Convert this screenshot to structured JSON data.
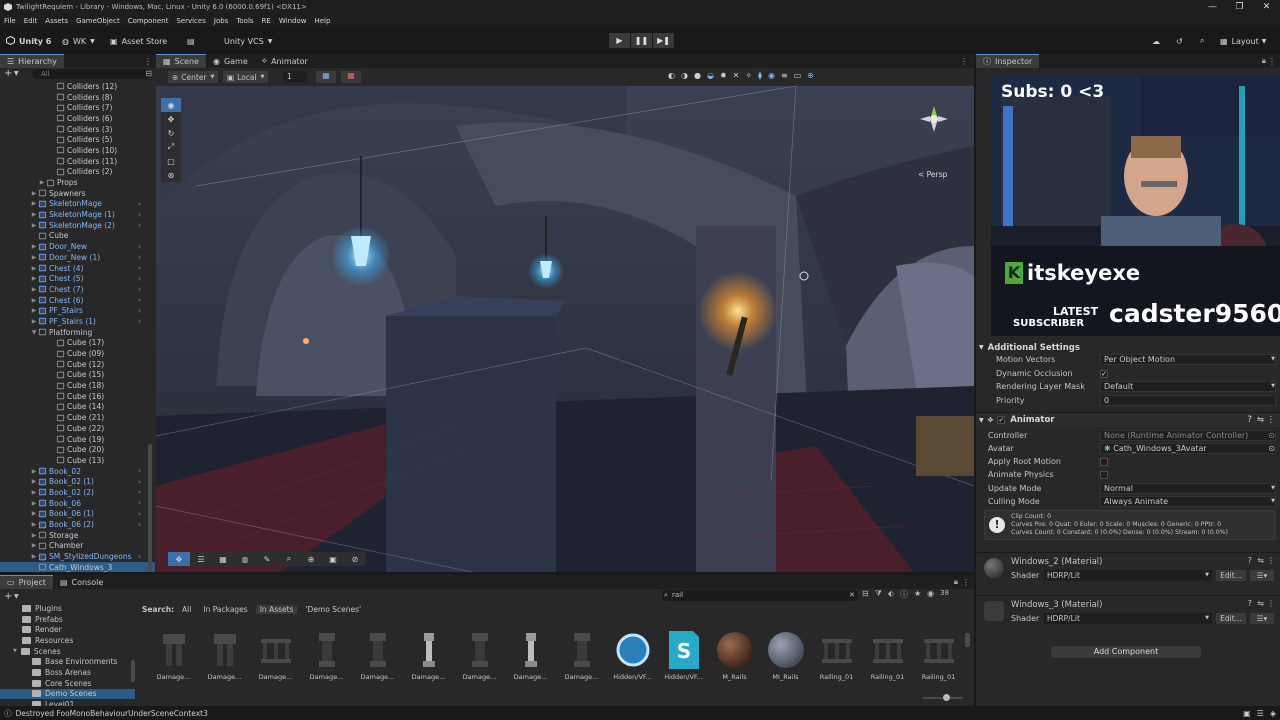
{
  "window": {
    "title": "TwilightRequiem - Library - Windows, Mac, Linux - Unity 6.0 (6000.0.69f1) <DX11>",
    "controls": [
      "—",
      "❐",
      "✕"
    ]
  },
  "menu": [
    "File",
    "Edit",
    "Assets",
    "GameObject",
    "Component",
    "Services",
    "Jobs",
    "Tools",
    "RE",
    "Window",
    "Help"
  ],
  "toolbar": {
    "unity_label": "Unity 6",
    "account_label": "WK",
    "asset_store_label": "Asset Store",
    "vcs_label": "Unity VCS",
    "layout_label": "Layout"
  },
  "hierarchy": {
    "tab_label": "Hierarchy",
    "search_placeholder": "All",
    "items": [
      {
        "label": "Colliders (12)",
        "prefab": false,
        "more": false
      },
      {
        "label": "Colliders (8)",
        "prefab": false,
        "more": false
      },
      {
        "label": "Colliders (7)",
        "prefab": false,
        "more": false
      },
      {
        "label": "Colliders (6)",
        "prefab": false,
        "more": false
      },
      {
        "label": "Colliders (3)",
        "prefab": false,
        "more": false
      },
      {
        "label": "Colliders (5)",
        "prefab": false,
        "more": false
      },
      {
        "label": "Colliders (10)",
        "prefab": false,
        "more": false
      },
      {
        "label": "Colliders (11)",
        "prefab": false,
        "more": false
      },
      {
        "label": "Colliders (2)",
        "prefab": false,
        "more": false
      },
      {
        "label": "Props",
        "prefab": false,
        "more": false
      },
      {
        "label": "Spawners",
        "prefab": false,
        "more": false
      },
      {
        "label": "SkeletonMage",
        "prefab": true,
        "more": true
      },
      {
        "label": "SkeletonMage (1)",
        "prefab": true,
        "more": true
      },
      {
        "label": "SkeletonMage (2)",
        "prefab": true,
        "more": true
      },
      {
        "label": "Cube",
        "prefab": false,
        "more": false
      },
      {
        "label": "Door_New",
        "prefab": true,
        "more": true
      },
      {
        "label": "Door_New (1)",
        "prefab": true,
        "more": true
      },
      {
        "label": "Chest (4)",
        "prefab": true,
        "more": true
      },
      {
        "label": "Chest (5)",
        "prefab": true,
        "more": true
      },
      {
        "label": "Chest (7)",
        "prefab": true,
        "more": true
      },
      {
        "label": "Chest (6)",
        "prefab": true,
        "more": true
      },
      {
        "label": "PF_Stairs",
        "prefab": true,
        "more": true
      },
      {
        "label": "PF_Stairs (1)",
        "prefab": true,
        "more": true
      },
      {
        "label": "Platforming",
        "prefab": false,
        "more": false
      },
      {
        "label": "Cube (17)",
        "prefab": false,
        "more": false
      },
      {
        "label": "Cube (09)",
        "prefab": false,
        "more": false
      },
      {
        "label": "Cube (12)",
        "prefab": false,
        "more": false
      },
      {
        "label": "Cube (15)",
        "prefab": false,
        "more": false
      },
      {
        "label": "Cube (18)",
        "prefab": false,
        "more": false
      },
      {
        "label": "Cube (16)",
        "prefab": false,
        "more": false
      },
      {
        "label": "Cube (14)",
        "prefab": false,
        "more": false
      },
      {
        "label": "Cube (21)",
        "prefab": false,
        "more": false
      },
      {
        "label": "Cube (22)",
        "prefab": false,
        "more": false
      },
      {
        "label": "Cube (19)",
        "prefab": false,
        "more": false
      },
      {
        "label": "Cube (20)",
        "prefab": false,
        "more": false
      },
      {
        "label": "Cube (13)",
        "prefab": false,
        "more": false
      },
      {
        "label": "Book_02",
        "prefab": true,
        "more": true
      },
      {
        "label": "Book_02 (1)",
        "prefab": true,
        "more": true
      },
      {
        "label": "Book_02 (2)",
        "prefab": true,
        "more": true
      },
      {
        "label": "Book_06",
        "prefab": true,
        "more": true
      },
      {
        "label": "Book_06 (1)",
        "prefab": true,
        "more": true
      },
      {
        "label": "Book_06 (2)",
        "prefab": true,
        "more": true
      },
      {
        "label": "Storage",
        "prefab": false,
        "more": false
      },
      {
        "label": "Chamber",
        "prefab": false,
        "more": false
      },
      {
        "label": "SM_StylizedDungeons",
        "prefab": true,
        "more": true
      },
      {
        "label": "Cath_Windows_3",
        "prefab": false,
        "more": false
      }
    ]
  },
  "scene": {
    "tabs": [
      "Scene",
      "Game",
      "Animator"
    ],
    "pivot_label": "Center",
    "space_label": "Local",
    "snap_value": "1",
    "persp_label": "< Persp"
  },
  "inspector": {
    "tab_label": "Inspector",
    "additional_settings": {
      "header": "Additional Settings",
      "rows": [
        {
          "key": "Motion Vectors",
          "value": "Per Object Motion"
        },
        {
          "key": "Dynamic Occlusion",
          "value": "✓"
        },
        {
          "key": "Rendering Layer Mask",
          "value": "Default"
        },
        {
          "key": "Priority",
          "value": "0"
        }
      ]
    },
    "animator": {
      "header": "Animator",
      "rows": [
        {
          "key": "Controller",
          "value": "None (Runtime Animator Controller)"
        },
        {
          "key": "Avatar",
          "value": "Cath_Windows_3Avatar"
        },
        {
          "key": "Apply Root Motion",
          "value": ""
        },
        {
          "key": "Animate Physics",
          "value": ""
        },
        {
          "key": "Update Mode",
          "value": "Normal"
        },
        {
          "key": "Culling Mode",
          "value": "Always Animate"
        }
      ],
      "info_lines": [
        "Clip Count: 0",
        "Curves Pos: 0 Quat: 0 Euler: 0 Scale: 0 Muscles: 0 Generic: 0 PPtr: 0",
        "Curves Count: 0 Constant: 0 (0.0%) Dense: 0 (0.0%) Stream: 0 (0.0%)"
      ]
    },
    "materials": [
      {
        "name": "Windows_2 (Material)",
        "shader_key": "Shader",
        "shader": "HDRP/Lit",
        "edit": "Edit..."
      },
      {
        "name": "Windows_3 (Material)",
        "shader_key": "Shader",
        "shader": "HDRP/Lit",
        "edit": "Edit..."
      }
    ],
    "add_component": "Add Component"
  },
  "overlay": {
    "subs": "Subs: 0 <3",
    "channel": "itskeyexe",
    "latest": "LATEST",
    "subscriber": "SUBSCRIBER",
    "latest_name": "cadster9560"
  },
  "project": {
    "tabs": [
      "Project",
      "Console"
    ],
    "search_value": "rail",
    "count": "38",
    "search_label": "Search:",
    "filters": [
      "All",
      "In Packages",
      "In Assets",
      "'Demo Scenes'"
    ],
    "folders": [
      {
        "label": "Plugins",
        "indent": 1,
        "selected": false
      },
      {
        "label": "Prefabs",
        "indent": 1,
        "selected": false
      },
      {
        "label": "Render",
        "indent": 1,
        "selected": false
      },
      {
        "label": "Resources",
        "indent": 1,
        "selected": false
      },
      {
        "label": "Scenes",
        "indent": 1,
        "selected": false
      },
      {
        "label": "Base Environments",
        "indent": 2,
        "selected": false
      },
      {
        "label": "Boss Arenas",
        "indent": 2,
        "selected": false
      },
      {
        "label": "Core Scenes",
        "indent": 2,
        "selected": false
      },
      {
        "label": "Demo Scenes",
        "indent": 2,
        "selected": true
      },
      {
        "label": "Level01",
        "indent": 2,
        "selected": false
      }
    ],
    "assets": [
      {
        "name": "Damage...",
        "kind": "mesh-dark"
      },
      {
        "name": "Damage...",
        "kind": "mesh-dark"
      },
      {
        "name": "Damage...",
        "kind": "mesh-rail"
      },
      {
        "name": "Damage...",
        "kind": "mesh-pillar"
      },
      {
        "name": "Damage...",
        "kind": "mesh-pillar"
      },
      {
        "name": "Damage...",
        "kind": "mesh-light"
      },
      {
        "name": "Damage...",
        "kind": "mesh-pillar"
      },
      {
        "name": "Damage...",
        "kind": "mesh-light"
      },
      {
        "name": "Damage...",
        "kind": "mesh-pillar"
      },
      {
        "name": "Hidden/VF...",
        "kind": "ring"
      },
      {
        "name": "Hidden/VF...",
        "kind": "shader"
      },
      {
        "name": "M_Rails",
        "kind": "sphere-brown"
      },
      {
        "name": "MI_Rails",
        "kind": "sphere-grey"
      },
      {
        "name": "Railing_01",
        "kind": "mesh-rail"
      },
      {
        "name": "Railing_01",
        "kind": "mesh-rail"
      },
      {
        "name": "Railing_01",
        "kind": "mesh-rail"
      }
    ]
  },
  "status": {
    "message": "Destroyed FooMonoBehaviourUnderSceneContext3"
  }
}
